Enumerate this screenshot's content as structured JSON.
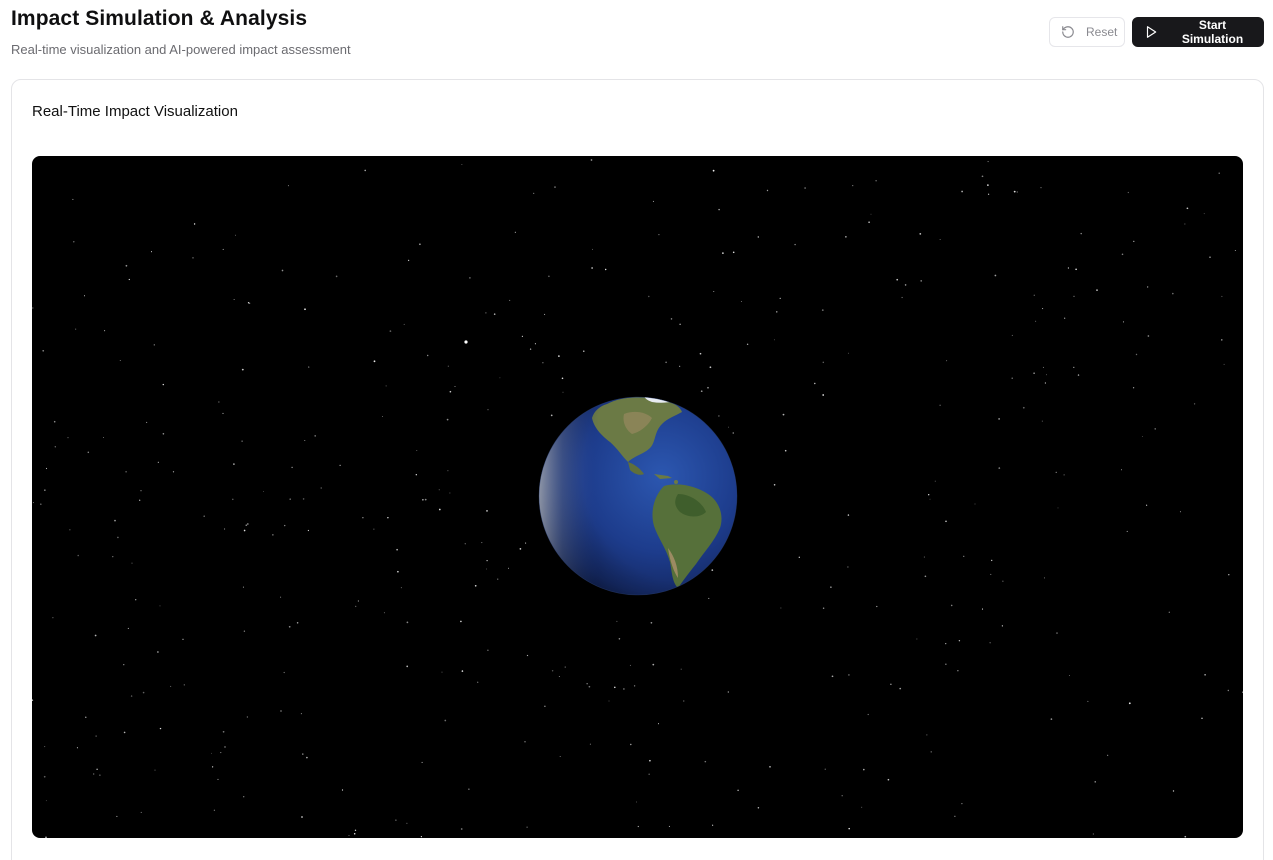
{
  "header": {
    "title": "Impact Simulation & Analysis",
    "subtitle": "Real-time visualization and AI-powered impact assessment"
  },
  "actions": {
    "reset_label": "Reset",
    "reset_icon": "rotate-ccw-icon",
    "start_label": "Start Simulation",
    "start_icon": "play-icon"
  },
  "visualization": {
    "title": "Real-Time Impact Visualization",
    "background_color": "#000000",
    "earth_ocean_color": "#1f3f8f",
    "land_color": "#4f6b2c"
  }
}
